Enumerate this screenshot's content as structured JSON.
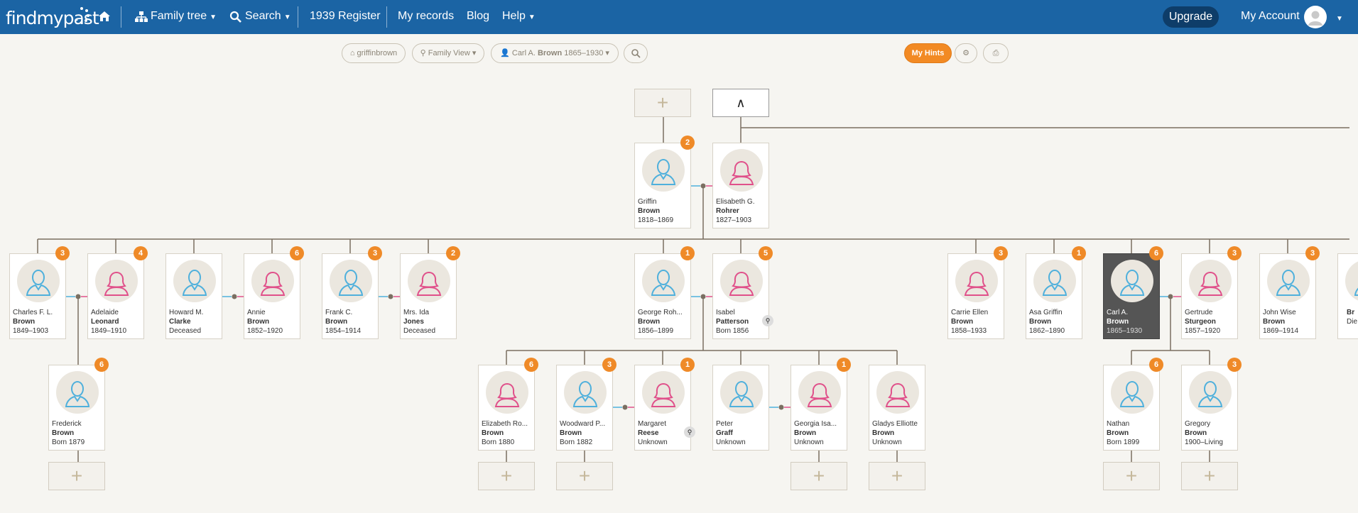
{
  "nav": {
    "logo": "findmypast",
    "family_tree": "Family tree",
    "search": "Search",
    "register": "1939 Register",
    "my_records": "My records",
    "blog": "Blog",
    "help": "Help",
    "upgrade": "Upgrade",
    "account": "My Account"
  },
  "toolbar": {
    "tree_name": "griffinbrown",
    "view": "Family View",
    "person_first": "Carl A.",
    "person_surname": "Brown",
    "person_dates": "1865–1930",
    "hints": "My Hints"
  },
  "controls": {
    "add": "+",
    "up": "∧"
  },
  "colors": {
    "male": "#4fb0dc",
    "female": "#e0508a",
    "badge": "#ef8a28",
    "header": "#1b64a4"
  },
  "people": [
    {
      "first": "Griffin",
      "surname": "Brown",
      "dates": "1818–1869",
      "gender": "m",
      "badge": "2"
    },
    {
      "first": "Elisabeth G.",
      "surname": "Rohrer",
      "dates": "1827–1903",
      "gender": "f",
      "badge": ""
    },
    {
      "first": "Charles F. L.",
      "surname": "Brown",
      "dates": "1849–1903",
      "gender": "m",
      "badge": "3"
    },
    {
      "first": "Adelaide",
      "surname": "Leonard",
      "dates": "1849–1910",
      "gender": "f",
      "badge": "4"
    },
    {
      "first": "Howard M.",
      "surname": "Clarke",
      "dates": "Deceased",
      "gender": "m",
      "badge": ""
    },
    {
      "first": "Annie",
      "surname": "Brown",
      "dates": "1852–1920",
      "gender": "f",
      "badge": "6"
    },
    {
      "first": "Frank C.",
      "surname": "Brown",
      "dates": "1854–1914",
      "gender": "m",
      "badge": "3"
    },
    {
      "first": "Mrs. Ida",
      "surname": "Jones",
      "dates": "Deceased",
      "gender": "f",
      "badge": "2"
    },
    {
      "first": "George Roh...",
      "surname": "Brown",
      "dates": "1856–1899",
      "gender": "m",
      "badge": "1"
    },
    {
      "first": "Isabel",
      "surname": "Patterson",
      "dates": "Born 1856",
      "gender": "f",
      "badge": "5"
    },
    {
      "first": "Carrie Ellen",
      "surname": "Brown",
      "dates": "1858–1933",
      "gender": "f",
      "badge": "3"
    },
    {
      "first": "Asa Griffin",
      "surname": "Brown",
      "dates": "1862–1890",
      "gender": "m",
      "badge": "1"
    },
    {
      "first": "Carl A.",
      "surname": "Brown",
      "dates": "1865–1930",
      "gender": "m",
      "badge": "6"
    },
    {
      "first": "Gertrude",
      "surname": "Sturgeon",
      "dates": "1857–1920",
      "gender": "f",
      "badge": "3"
    },
    {
      "first": "John Wise",
      "surname": "Brown",
      "dates": "1869–1914",
      "gender": "m",
      "badge": "3"
    },
    {
      "first": "Br",
      "surname": "",
      "dates": "Die",
      "gender": "m",
      "badge": ""
    },
    {
      "first": "Frederick",
      "surname": "Brown",
      "dates": "Born 1879",
      "gender": "m",
      "badge": "6"
    },
    {
      "first": "Elizabeth Ro...",
      "surname": "Brown",
      "dates": "Born 1880",
      "gender": "f",
      "badge": "6"
    },
    {
      "first": "Woodward P...",
      "surname": "Brown",
      "dates": "Born 1882",
      "gender": "m",
      "badge": "3"
    },
    {
      "first": "Margaret",
      "surname": "Reese",
      "dates": "Unknown",
      "gender": "f",
      "badge": "1"
    },
    {
      "first": "Peter",
      "surname": "Graff",
      "dates": "Unknown",
      "gender": "m",
      "badge": ""
    },
    {
      "first": "Georgia Isa...",
      "surname": "Brown",
      "dates": "Unknown",
      "gender": "f",
      "badge": "1"
    },
    {
      "first": "Gladys Elliotte",
      "surname": "Brown",
      "dates": "Unknown",
      "gender": "f",
      "badge": ""
    },
    {
      "first": "Nathan",
      "surname": "Brown",
      "dates": "Born 1899",
      "gender": "m",
      "badge": "6"
    },
    {
      "first": "Gregory",
      "surname": "Brown",
      "dates": "1900–Living",
      "gender": "m",
      "badge": "3"
    }
  ]
}
